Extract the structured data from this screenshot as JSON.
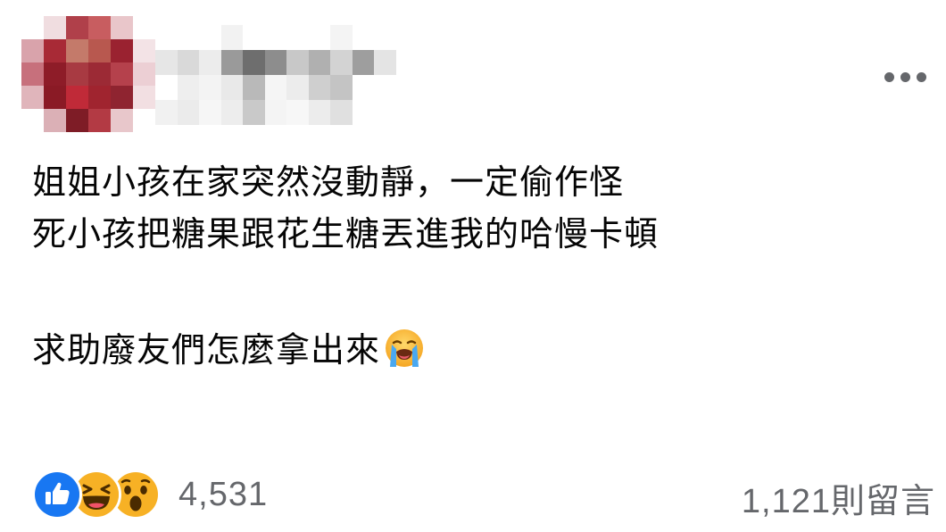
{
  "post": {
    "lines": [
      "姐姐小孩在家突然沒動靜，一定偷作怪",
      "死小孩把糖果跟花生糖丟進我的哈慢卡頓",
      "求助廢友們怎麼拿出來"
    ],
    "trailing_emoji": "loudly-crying-face"
  },
  "reactions": {
    "types": [
      "like",
      "haha",
      "wow"
    ],
    "count": "4,531"
  },
  "comments": {
    "label": "1,121則留言"
  },
  "colors": {
    "text": "#050505",
    "secondary_text": "#65676b",
    "like_blue": "#1877f2",
    "reaction_yellow": "#f7b125"
  }
}
